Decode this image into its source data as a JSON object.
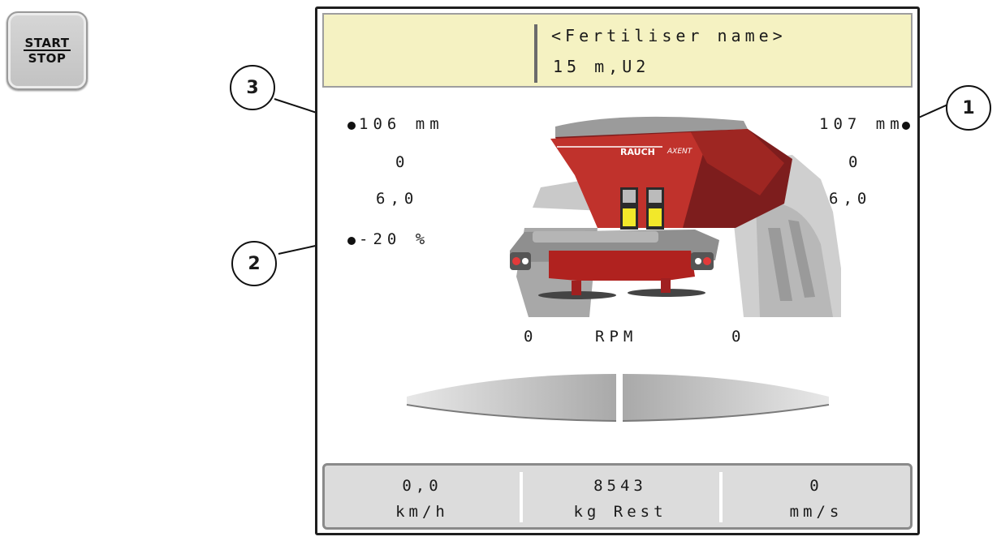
{
  "start_stop": {
    "top": "START",
    "bottom": "STOP"
  },
  "header": {
    "fertiliser": "<Fertiliser name>",
    "setting": "15 m,U2"
  },
  "left": {
    "pos": "106 mm",
    "v2": "0",
    "v3": "6,0",
    "pct": "-20 %"
  },
  "right": {
    "pos": "107 mm",
    "v2": "0",
    "v3": "6,0"
  },
  "spreader": {
    "brand": "RAUCH",
    "model": "AXENT"
  },
  "rpm": {
    "left": "0",
    "label": "RPM",
    "right": "0"
  },
  "footer": [
    {
      "value": "0,0",
      "unit": "km/h"
    },
    {
      "value": "8543",
      "unit": "kg Rest"
    },
    {
      "value": "0",
      "unit": "mm/s"
    }
  ],
  "callouts": [
    "1",
    "2",
    "3"
  ]
}
